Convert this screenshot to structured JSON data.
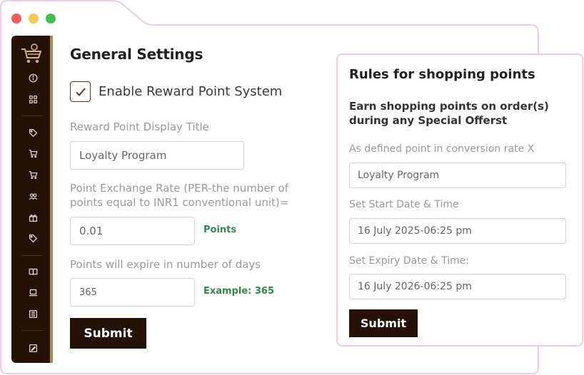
{
  "colors": {
    "sidebar_bg": "#241208",
    "sidebar_accent": "#b08a49",
    "frame_border": "#f2c9ee",
    "button_bg": "#241208",
    "hint_green": "#2f8a4b",
    "traffic_red": "#ee5c5c",
    "traffic_yellow": "#f5c85a",
    "traffic_green": "#3fbf4f"
  },
  "sidebar": {
    "logo": "shopping-cart-logo",
    "icons": [
      "info-icon",
      "grid-icon",
      "tag-icon",
      "cart-icon",
      "cart-icon",
      "users-icon",
      "gift-icon",
      "tag-icon",
      "book-icon",
      "laptop-icon",
      "list-icon",
      "edit-icon"
    ]
  },
  "general": {
    "title": "General Settings",
    "enable_label": "Enable Reward Point System",
    "enable_checked": true,
    "display_title_label": "Reward Point Display Title",
    "display_title_value": "Loyalty Program",
    "exchange_label_line1": "Point Exchange Rate (PER-the number of",
    "exchange_label_line2": "points equal to INR1 conventional unit)=",
    "exchange_value": "0.01",
    "exchange_hint": "Points",
    "expire_label": "Points will expire in number of days",
    "expire_value": "365",
    "expire_hint": "Example: 365",
    "submit_label": "Submit"
  },
  "rules": {
    "title": "Rules for shopping points",
    "subtitle_line1": "Earn shopping points on order(s)",
    "subtitle_line2": "during any Special Offerst",
    "conversion_label": "As defined point in conversion rate X",
    "conversion_value": "Loyalty Program",
    "start_label": "Set Start Date & Time",
    "start_value": "16 July 2025-06:25 pm",
    "expiry_label": "Set Expiry Date & Time:",
    "expiry_value": "16 July 2026-06:25 pm",
    "submit_label": "Submit"
  }
}
